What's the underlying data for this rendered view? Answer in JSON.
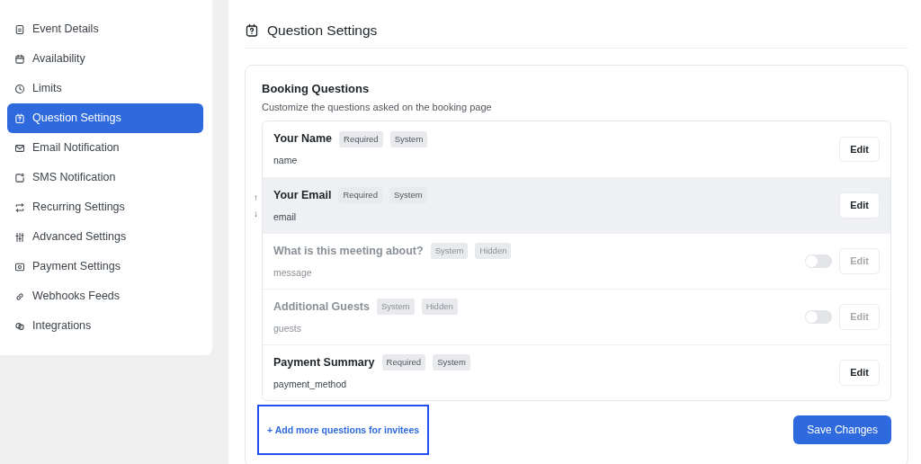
{
  "sidebar": {
    "items": [
      {
        "label": "Event Details",
        "selected": false
      },
      {
        "label": "Availability",
        "selected": false
      },
      {
        "label": "Limits",
        "selected": false
      },
      {
        "label": "Question Settings",
        "selected": true
      },
      {
        "label": "Email Notification",
        "selected": false
      },
      {
        "label": "SMS Notification",
        "selected": false
      },
      {
        "label": "Recurring Settings",
        "selected": false
      },
      {
        "label": "Advanced Settings",
        "selected": false
      },
      {
        "label": "Payment Settings",
        "selected": false
      },
      {
        "label": "Webhooks Feeds",
        "selected": false
      },
      {
        "label": "Integrations",
        "selected": false
      }
    ]
  },
  "page_title": "Question Settings",
  "card": {
    "title": "Booking Questions",
    "subtitle": "Customize the questions asked on the booking page",
    "questions": [
      {
        "kind": "fixed",
        "label": "Your Name",
        "tags": [
          "Required",
          "System"
        ],
        "field": "name",
        "hovered": false,
        "button": "Edit"
      },
      {
        "kind": "fixed",
        "label": "Your Email",
        "tags": [
          "Required",
          "System"
        ],
        "field": "email",
        "hovered": true,
        "button": "Edit"
      },
      {
        "kind": "optional",
        "label": "What is this meeting about?",
        "tags": [
          "System",
          "Hidden"
        ],
        "field": "message",
        "hovered": false,
        "on": false,
        "button": "Edit"
      },
      {
        "kind": "optional",
        "label": "Additional Guests",
        "tags": [
          "System",
          "Hidden"
        ],
        "field": "guests",
        "hovered": false,
        "on": false,
        "button": "Edit"
      },
      {
        "kind": "fixed",
        "label": "Payment Summary",
        "tags": [
          "Required",
          "System"
        ],
        "field": "payment_method",
        "hovered": false,
        "button": "Edit"
      }
    ],
    "reorder_arrows": [
      "↑",
      "↓"
    ],
    "add_link": "+ Add more questions for invitees",
    "add_link_highlighted": true,
    "save_button": "Save Changes"
  }
}
